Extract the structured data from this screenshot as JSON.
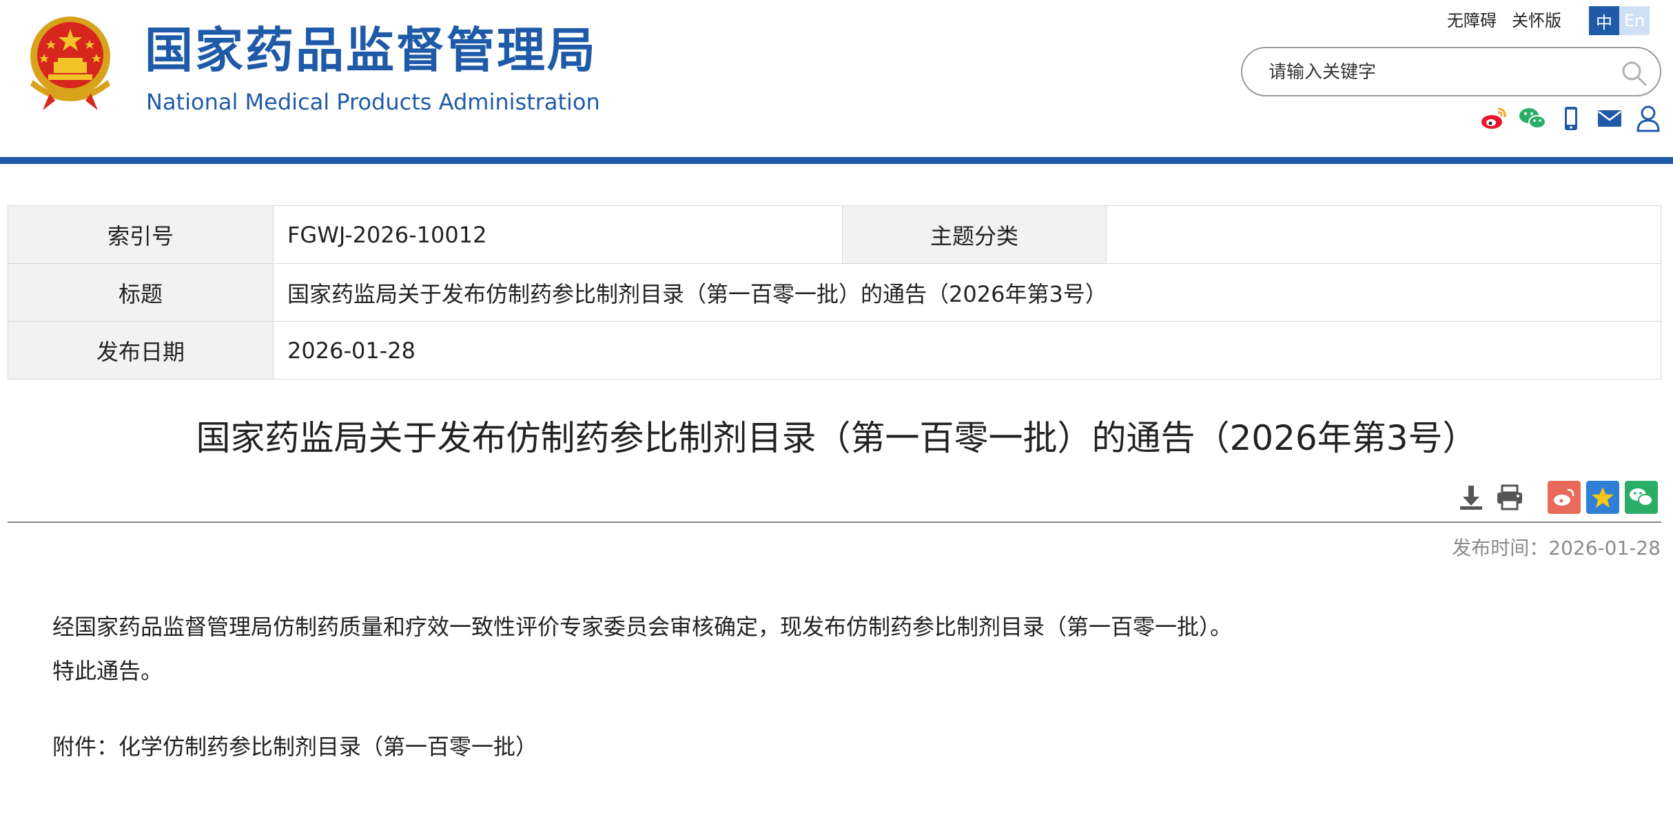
{
  "header": {
    "title_cn": "国家药品监督管理局",
    "title_en": "National Medical Products Administration",
    "emblem_icon": "national-emblem-icon",
    "top_links": [
      "无障碍",
      "关怀版"
    ],
    "lang": {
      "zh": "中",
      "en": "En"
    },
    "search": {
      "placeholder": "请输入关键字",
      "icon": "search-icon"
    },
    "social_icons": [
      "weibo-icon",
      "wechat-icon",
      "mobile-icon",
      "mail-icon",
      "user-icon"
    ],
    "brand_color": "#1f5aa8"
  },
  "info": {
    "index_label": "索引号",
    "index_value": "FGWJ-2026-10012",
    "topic_label": "主题分类",
    "topic_value": "",
    "title_label": "标题",
    "title_value": "国家药监局关于发布仿制药参比制剂目录（第一百零一批）的通告（2026年第3号）",
    "date_label": "发布日期",
    "date_value": "2026-01-28"
  },
  "article": {
    "title": "国家药监局关于发布仿制药参比制剂目录（第一百零一批）的通告（2026年第3号）",
    "tools": [
      "download-icon",
      "print-icon"
    ],
    "share": [
      "weibo-share-icon",
      "favorite-star-icon",
      "wechat-share-icon"
    ],
    "pub_label": "发布时间：",
    "pub_date": "2026-01-28",
    "paragraph1": "经国家药品监督管理局仿制药质量和疗效一致性评价专家委员会审核确定，现发布仿制药参比制剂目录（第一百零一批）。",
    "paragraph2": "特此通告。",
    "attachment": "附件：化学仿制药参比制剂目录（第一百零一批）"
  }
}
